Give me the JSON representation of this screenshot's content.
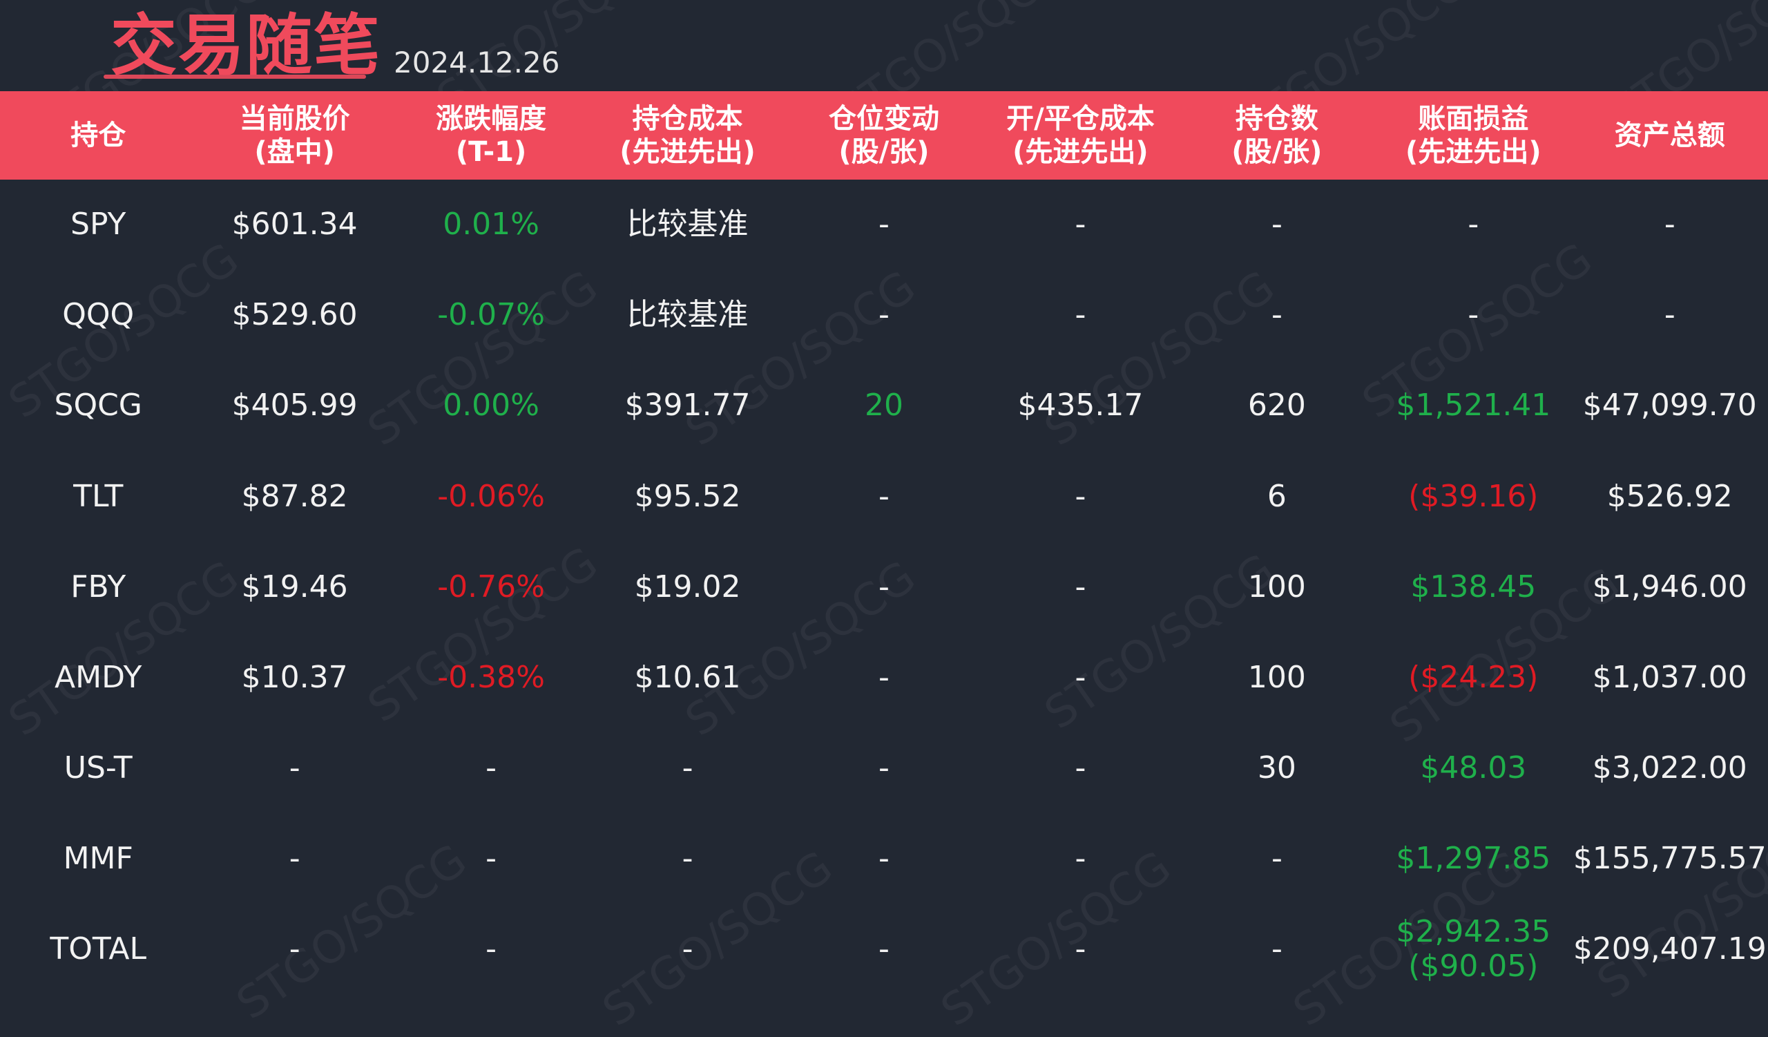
{
  "header": {
    "title": "交易随笔",
    "date": "2024.12.26",
    "watermark": "STGO/SQCG"
  },
  "colors": {
    "background": "#222833",
    "header_bg": "#f04a5c",
    "accent_title": "#f04a5c",
    "gain": "#1fb04b",
    "loss": "#e01b24",
    "text": "#f2f2f2"
  },
  "table": {
    "headers": [
      {
        "line1": "持仓",
        "line2": ""
      },
      {
        "line1": "当前股价",
        "line2": "(盘中)"
      },
      {
        "line1": "涨跌幅度",
        "line2": "(T-1)"
      },
      {
        "line1": "持仓成本",
        "line2": "(先进先出)"
      },
      {
        "line1": "仓位变动",
        "line2": "(股/张)"
      },
      {
        "line1": "开/平仓成本",
        "line2": "(先进先出)"
      },
      {
        "line1": "持仓数",
        "line2": "(股/张)"
      },
      {
        "line1": "账面损益",
        "line2": "(先进先出)"
      },
      {
        "line1": "资产总额",
        "line2": ""
      }
    ],
    "rows": [
      {
        "ticker": "SPY",
        "price": "$601.34",
        "change": "0.01%",
        "change_status": "green",
        "cost": "比较基准",
        "position_change": "-",
        "position_change_status": "",
        "open_close_cost": "-",
        "shares": "-",
        "pnl": "-",
        "pnl_status": "",
        "pnl2": "",
        "total": "-"
      },
      {
        "ticker": "QQQ",
        "price": "$529.60",
        "change": "-0.07%",
        "change_status": "green",
        "cost": "比较基准",
        "position_change": "-",
        "position_change_status": "",
        "open_close_cost": "-",
        "shares": "-",
        "pnl": "-",
        "pnl_status": "",
        "pnl2": "",
        "total": "-"
      },
      {
        "ticker": "SQCG",
        "price": "$405.99",
        "change": "0.00%",
        "change_status": "green",
        "cost": "$391.77",
        "position_change": "20",
        "position_change_status": "green",
        "open_close_cost": "$435.17",
        "shares": "620",
        "pnl": "$1,521.41",
        "pnl_status": "green",
        "pnl2": "",
        "total": "$47,099.70"
      },
      {
        "ticker": "TLT",
        "price": "$87.82",
        "change": "-0.06%",
        "change_status": "red",
        "cost": "$95.52",
        "position_change": "-",
        "position_change_status": "",
        "open_close_cost": "-",
        "shares": "6",
        "pnl": "($39.16)",
        "pnl_status": "red",
        "pnl2": "",
        "total": "$526.92"
      },
      {
        "ticker": "FBY",
        "price": "$19.46",
        "change": "-0.76%",
        "change_status": "red",
        "cost": "$19.02",
        "position_change": "-",
        "position_change_status": "",
        "open_close_cost": "-",
        "shares": "100",
        "pnl": "$138.45",
        "pnl_status": "green",
        "pnl2": "",
        "total": "$1,946.00"
      },
      {
        "ticker": "AMDY",
        "price": "$10.37",
        "change": "-0.38%",
        "change_status": "red",
        "cost": "$10.61",
        "position_change": "-",
        "position_change_status": "",
        "open_close_cost": "-",
        "shares": "100",
        "pnl": "($24.23)",
        "pnl_status": "red",
        "pnl2": "",
        "total": "$1,037.00"
      },
      {
        "ticker": "US-T",
        "price": "-",
        "change": "-",
        "change_status": "",
        "cost": "-",
        "position_change": "-",
        "position_change_status": "",
        "open_close_cost": "-",
        "shares": "30",
        "pnl": "$48.03",
        "pnl_status": "green",
        "pnl2": "",
        "total": "$3,022.00"
      },
      {
        "ticker": "MMF",
        "price": "-",
        "change": "-",
        "change_status": "",
        "cost": "-",
        "position_change": "-",
        "position_change_status": "",
        "open_close_cost": "-",
        "shares": "-",
        "pnl": "$1,297.85",
        "pnl_status": "green",
        "pnl2": "",
        "total": "$155,775.57"
      },
      {
        "ticker": "TOTAL",
        "price": "-",
        "change": "-",
        "change_status": "",
        "cost": "-",
        "position_change": "-",
        "position_change_status": "",
        "open_close_cost": "-",
        "shares": "-",
        "pnl": "$2,942.35",
        "pnl_status": "green",
        "pnl2": "($90.05)",
        "total": "$209,407.19"
      }
    ]
  }
}
